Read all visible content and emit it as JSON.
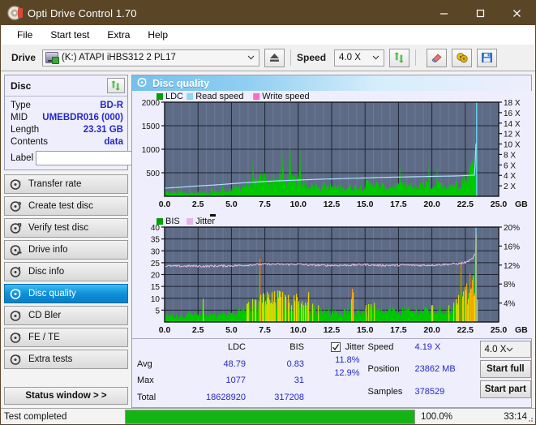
{
  "window": {
    "title": "Opti Drive Control 1.70",
    "icon": "disc-icon",
    "minimize": "minimize-icon",
    "maximize": "maximize-icon",
    "close": "close-icon"
  },
  "menu": {
    "items": [
      "File",
      "Start test",
      "Extra",
      "Help"
    ]
  },
  "toolbar": {
    "drive_label": "Drive",
    "drive_value": "(K:)  ATAPI iHBS312  2 PL17",
    "eject_icon": "eject-icon",
    "speed_label": "Speed",
    "speed_value": "4.0 X",
    "refresh_icon": "refresh-icon",
    "erase_icon": "eraser-icon",
    "bitsetting_icon": "bitsetting-icon",
    "save_icon": "save-icon"
  },
  "disc_panel": {
    "title": "Disc",
    "refresh_icon": "refresh-icon",
    "rows": [
      {
        "key": "Type",
        "value": "BD-R"
      },
      {
        "key": "MID",
        "value": "UMEBDR016 (000)"
      },
      {
        "key": "Length",
        "value": "23.31 GB"
      },
      {
        "key": "Contents",
        "value": "data"
      }
    ],
    "label_key": "Label",
    "label_value": "",
    "label_placeholder": "",
    "disc_icon": "cd-icon"
  },
  "sidebar": {
    "items": [
      {
        "label": "Transfer rate",
        "icon": "disc-test-icon",
        "active": false
      },
      {
        "label": "Create test disc",
        "icon": "disc-burn-icon",
        "active": false
      },
      {
        "label": "Verify test disc",
        "icon": "disc-verify-icon",
        "active": false
      },
      {
        "label": "Drive info",
        "icon": "drive-info-icon",
        "active": false
      },
      {
        "label": "Disc info",
        "icon": "disc-info-icon",
        "active": false
      },
      {
        "label": "Disc quality",
        "icon": "disc-quality-icon",
        "active": true
      },
      {
        "label": "CD Bler",
        "icon": "cd-bler-icon",
        "active": false
      },
      {
        "label": "FE / TE",
        "icon": "fe-te-icon",
        "active": false
      },
      {
        "label": "Extra tests",
        "icon": "extra-tests-icon",
        "active": false
      }
    ],
    "status_window_button": "Status window > >"
  },
  "panel": {
    "title": "Disc quality",
    "icon": "disc-quality-icon"
  },
  "chart_data": [
    {
      "type": "area",
      "name": "ldc-chart",
      "title": "",
      "legend": [
        {
          "label": "LDC",
          "color": "#00a000"
        },
        {
          "label": "Read speed",
          "color": "#8cd8f5"
        },
        {
          "label": "Write speed",
          "color": "#ff66cc"
        }
      ],
      "legend_position": "top-left",
      "xlabel": "GB",
      "ylabel": "",
      "xlim": [
        0,
        25
      ],
      "ylim": [
        0,
        2000
      ],
      "xticks": [
        "0.0",
        "2.5",
        "5.0",
        "7.5",
        "10.0",
        "12.5",
        "15.0",
        "17.5",
        "20.0",
        "22.5",
        "25.0"
      ],
      "yticks_left": [
        "500",
        "1000",
        "1500",
        "2000"
      ],
      "yticks_right": [
        "2 X",
        "4 X",
        "6 X",
        "8 X",
        "10 X",
        "12 X",
        "14 X",
        "16 X",
        "18 X"
      ],
      "y2lim": [
        0,
        18
      ],
      "grid": true,
      "plot_bg": "#5e6b86",
      "series": [
        {
          "name": "LDC",
          "color": "#00c800",
          "kind": "area",
          "x": [
            0.0,
            0.5,
            1.0,
            1.5,
            2.0,
            2.5,
            3.0,
            3.5,
            4.0,
            4.5,
            5.0,
            5.5,
            6.0,
            6.5,
            7.0,
            7.5,
            8.0,
            8.5,
            9.0,
            9.5,
            10.0,
            10.5,
            11.0,
            11.5,
            12.0,
            12.5,
            13.0,
            13.5,
            14.0,
            14.5,
            15.0,
            15.5,
            16.0,
            16.5,
            17.0,
            17.5,
            18.0,
            18.5,
            19.0,
            19.5,
            20.0,
            20.5,
            21.0,
            21.5,
            22.0,
            22.5,
            23.0,
            23.3,
            23.4
          ],
          "values": [
            90,
            80,
            85,
            75,
            80,
            85,
            95,
            100,
            110,
            120,
            150,
            200,
            260,
            300,
            340,
            430,
            400,
            420,
            380,
            360,
            420,
            300,
            250,
            230,
            230,
            220,
            210,
            200,
            210,
            220,
            250,
            340,
            230,
            220,
            230,
            240,
            250,
            230,
            240,
            250,
            260,
            250,
            260,
            280,
            300,
            420,
            700,
            1050,
            0
          ]
        },
        {
          "name": "Read speed",
          "color": "#a8e2fa",
          "kind": "line",
          "x": [
            0.0,
            1.0,
            2.0,
            3.0,
            4.0,
            5.0,
            6.0,
            7.0,
            8.0,
            9.0,
            10.0,
            11.0,
            12.0,
            13.0,
            14.0,
            15.0,
            16.0,
            17.0,
            18.0,
            19.0,
            20.0,
            21.0,
            22.0,
            22.8,
            23.2,
            23.3,
            23.35
          ],
          "values": [
            1.55,
            1.7,
            1.9,
            2.05,
            2.2,
            2.4,
            2.6,
            2.75,
            2.9,
            3.0,
            3.1,
            3.2,
            3.3,
            3.35,
            3.45,
            3.5,
            3.6,
            3.65,
            3.7,
            3.75,
            3.8,
            3.85,
            3.9,
            4.0,
            4.05,
            10.0,
            18.0
          ]
        }
      ]
    },
    {
      "type": "area",
      "name": "bis-jitter-chart",
      "title": "",
      "legend": [
        {
          "label": "BIS",
          "color": "#00a000"
        },
        {
          "label": "Jitter",
          "color": "#e6b6e6"
        }
      ],
      "legend_position": "top-left",
      "xlabel": "GB",
      "ylabel": "",
      "xlim": [
        0,
        25
      ],
      "ylim": [
        0,
        40
      ],
      "xticks": [
        "0.0",
        "2.5",
        "5.0",
        "7.5",
        "10.0",
        "12.5",
        "15.0",
        "17.5",
        "20.0",
        "22.5",
        "25.0"
      ],
      "yticks_left": [
        "5",
        "10",
        "15",
        "20",
        "25",
        "30",
        "35",
        "40"
      ],
      "yticks_right": [
        "4%",
        "8%",
        "12%",
        "16%",
        "20%"
      ],
      "y2lim": [
        0,
        20
      ],
      "grid": true,
      "plot_bg": "#5e6b86",
      "series": [
        {
          "name": "BIS",
          "color": "#00c800",
          "kind": "area",
          "x": [
            0.0,
            0.5,
            1.0,
            1.5,
            2.0,
            2.5,
            3.0,
            3.5,
            4.0,
            4.5,
            5.0,
            5.5,
            6.0,
            6.5,
            7.0,
            7.5,
            8.0,
            8.5,
            9.0,
            9.5,
            10.0,
            10.5,
            11.0,
            11.5,
            12.0,
            12.5,
            13.0,
            13.5,
            14.0,
            14.5,
            15.0,
            15.5,
            16.0,
            16.5,
            17.0,
            17.5,
            18.0,
            18.5,
            19.0,
            19.5,
            20.0,
            20.5,
            21.0,
            21.5,
            22.0,
            22.4,
            22.8,
            23.0,
            23.2,
            23.3,
            23.4
          ],
          "values": [
            3.2,
            3.0,
            3.1,
            3.0,
            3.2,
            3.1,
            3.3,
            3.2,
            3.4,
            3.6,
            4.0,
            4.6,
            6.0,
            7.2,
            8.5,
            10.5,
            9.5,
            10.5,
            9.0,
            8.5,
            9.5,
            7.0,
            6.0,
            5.5,
            5.0,
            4.8,
            4.6,
            4.5,
            4.6,
            4.8,
            5.2,
            6.5,
            4.8,
            4.6,
            4.8,
            5.0,
            5.2,
            4.8,
            5.0,
            5.2,
            5.4,
            5.2,
            5.4,
            6.0,
            9.0,
            10.5,
            15.0,
            17.0,
            22.0,
            29.0,
            0
          ]
        },
        {
          "name": "Jitter",
          "color": "#e8bde8",
          "kind": "line",
          "x": [
            0.0,
            1.0,
            2.0,
            3.0,
            4.0,
            5.0,
            6.0,
            7.0,
            8.0,
            9.0,
            10.0,
            11.0,
            12.0,
            13.0,
            14.0,
            15.0,
            16.0,
            17.0,
            18.0,
            19.0,
            20.0,
            21.0,
            22.0,
            22.6,
            23.0,
            23.3
          ],
          "values": [
            23.6,
            23.5,
            23.6,
            23.5,
            23.6,
            23.7,
            23.9,
            24.3,
            24.4,
            24.3,
            24.4,
            24.0,
            23.9,
            23.9,
            24.0,
            24.2,
            23.9,
            23.9,
            24.0,
            23.9,
            24.0,
            24.3,
            24.6,
            25.2,
            26.5,
            29.0
          ]
        }
      ]
    }
  ],
  "stats": {
    "col_headers": [
      "LDC",
      "BIS"
    ],
    "row_labels": [
      "Avg",
      "Max",
      "Total"
    ],
    "ldc": {
      "avg": "48.79",
      "max": "1077",
      "total": "18628920"
    },
    "bis": {
      "avg": "0.83",
      "max": "31",
      "total": "317208"
    },
    "jitter": {
      "label": "Jitter",
      "checked": true,
      "avg": "11.8%",
      "max": "12.9%"
    },
    "speed_label": "Speed",
    "speed_value": "4.19 X",
    "position_label": "Position",
    "position_value": "23862 MB",
    "samples_label": "Samples",
    "samples_value": "378529",
    "speed_select": "4.0 X",
    "start_full": "Start full",
    "start_part": "Start part"
  },
  "statusbar": {
    "text": "Test completed",
    "progress_pct": "100.0%",
    "progress_value": 100,
    "elapsed": "33:14"
  },
  "colors": {
    "titlebar": "#5a4526",
    "accent": "#0e8fd8",
    "value_blue": "#2727c8",
    "plot_bg": "#5e6b86",
    "green": "#00c800",
    "progress_green": "#14b414"
  }
}
